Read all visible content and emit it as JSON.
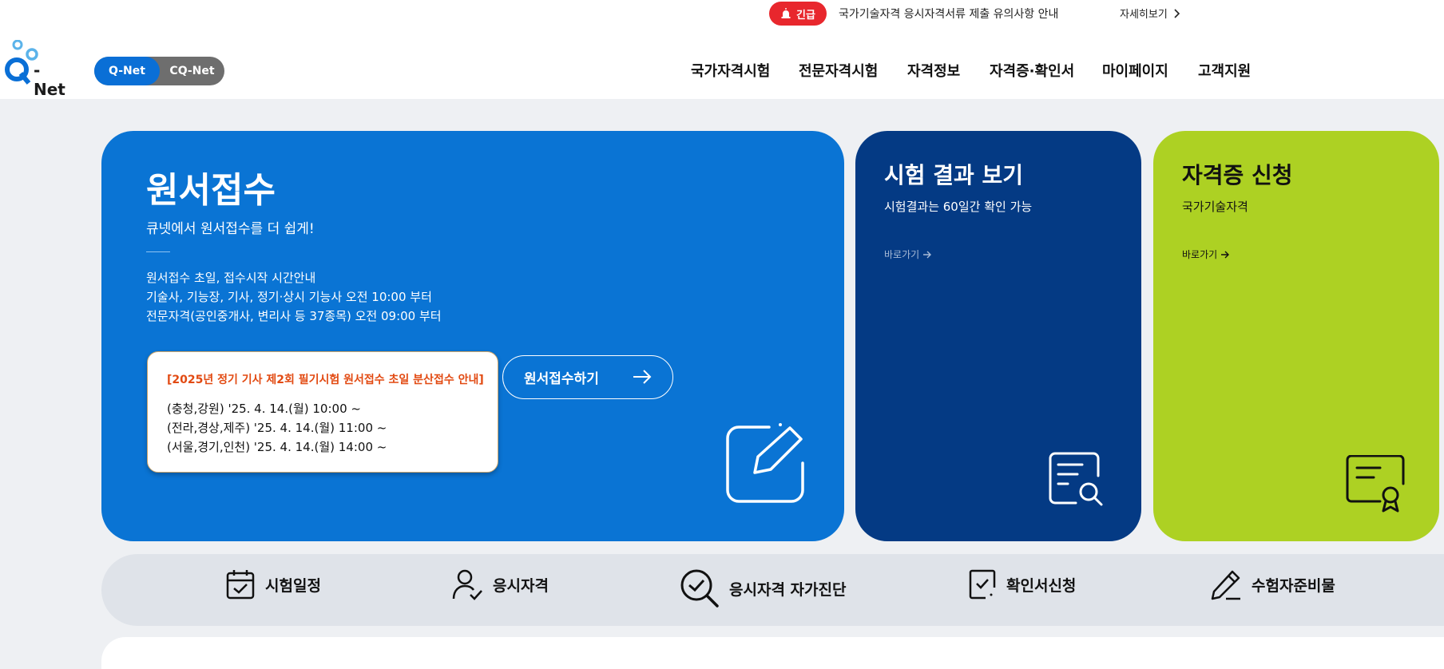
{
  "alert": {
    "badge": "긴급",
    "text": "국가기술자격 응시자격서류 제출 유의사항 안내",
    "more": "자세히보기"
  },
  "logo": {
    "text": "- Net"
  },
  "site_switch": {
    "active": "Q-Net",
    "inactive": "CQ-Net"
  },
  "nav": [
    "국가자격시험",
    "전문자격시험",
    "자격정보",
    "자격증·확인서",
    "마이페이지",
    "고객지원"
  ],
  "main_card": {
    "title": "원서접수",
    "subtitle": "큐넷에서 원서접수를 더 쉽게!",
    "info": [
      "원서접수 초일, 접수시작 시간안내",
      "기술사, 기능장, 기사, 정기·상시 기능사 오전 10:00 부터",
      "전문자격(공인중개사, 변리사 등 37종목) 오전 09:00 부터"
    ],
    "notice_title": "[2025년 정기 기사 제2회 필기시험 원서접수 초일 분산접수 안내]",
    "notice_lines": [
      "(충청,강원) '25. 4. 14.(월) 10:00 ~",
      "(전라,경상,제주) '25. 4. 14.(월) 11:00 ~",
      "(서울,경기,인천) '25. 4. 14.(월) 14:00 ~"
    ],
    "button": "원서접수하기"
  },
  "result_card": {
    "title": "시험 결과 보기",
    "subtitle": "시험결과는 60일간 확인 가능",
    "link": "바로가기"
  },
  "license_card": {
    "title": "자격증 신청",
    "subtitle": "국가기술자격",
    "link": "바로가기"
  },
  "quick_menu": [
    "시험일정",
    "응시자격",
    "응시자격 자가진단",
    "확인서신청",
    "수험자준비물"
  ],
  "colors": {
    "primary": "#0a74d4",
    "navy": "#043a84",
    "lime": "#add123",
    "alert": "#e8272d",
    "notice": "#e24a12"
  },
  "icons": [
    "siren-icon",
    "chevron-right-icon",
    "qnet-logo-icon",
    "arrow-right-icon",
    "edit-icon",
    "document-search-icon",
    "certificate-icon",
    "calendar-check-icon",
    "user-check-icon",
    "search-check-icon",
    "document-check-icon",
    "pencil-icon"
  ]
}
